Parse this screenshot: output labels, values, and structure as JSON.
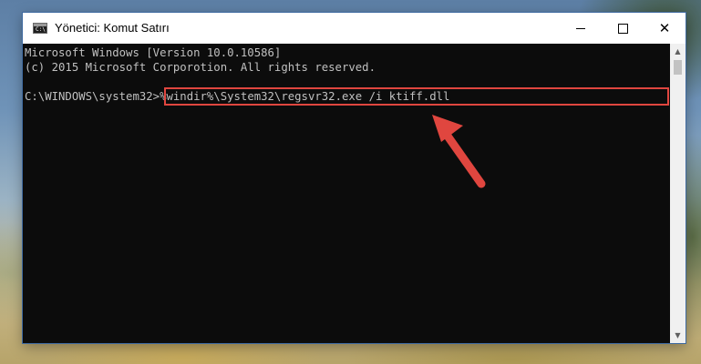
{
  "window": {
    "title": "Yönetici: Komut Satırı",
    "icon": "cmd-icon",
    "controls": {
      "minimize": "minimize-icon",
      "maximize": "maximize-icon",
      "close": "close-icon",
      "close_glyph": "✕"
    }
  },
  "console": {
    "lines": [
      "Microsoft Windows [Version 10.0.10586]",
      "(c) 2015 Microsoft Corporotion. All rights reserved."
    ],
    "prompt": "C:\\WINDOWS\\system32>",
    "command": "%windir%\\System32\\regsvr32.exe /i ktiff.dll"
  },
  "scrollbar": {
    "up_glyph": "▲",
    "down_glyph": "▼"
  },
  "colors": {
    "console_bg": "#0c0c0c",
    "console_text": "#c0c0c0",
    "highlight": "#e0463f",
    "arrow": "#e0463f"
  }
}
